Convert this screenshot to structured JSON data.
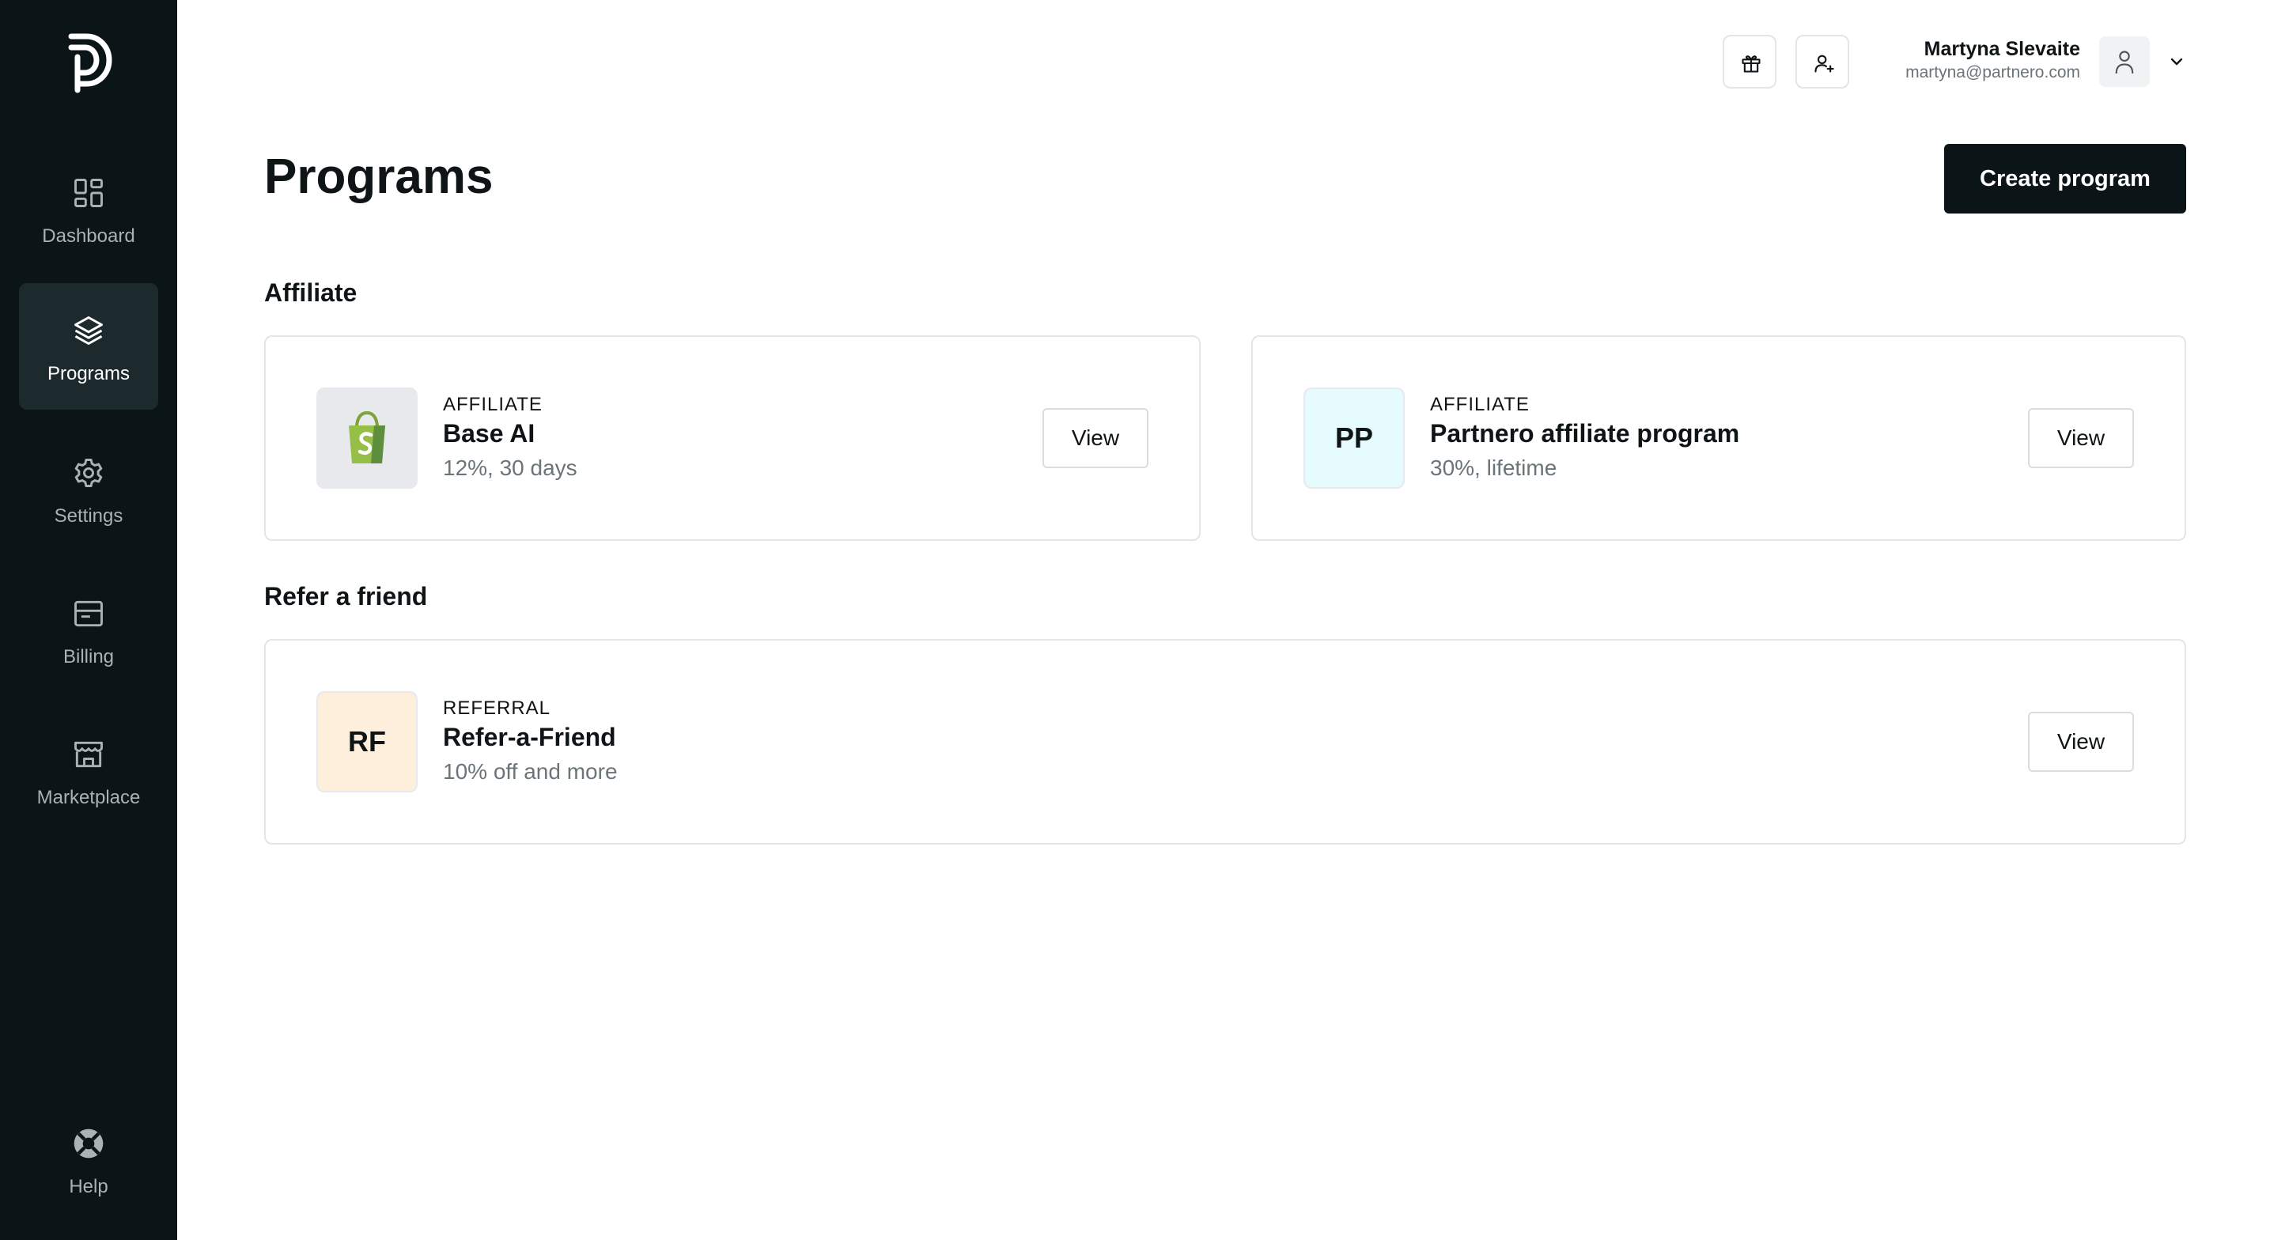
{
  "sidebar": {
    "items": [
      {
        "label": "Dashboard",
        "icon": "dashboard-grid-icon"
      },
      {
        "label": "Programs",
        "icon": "layers-icon",
        "active": true
      },
      {
        "label": "Settings",
        "icon": "gear-icon"
      },
      {
        "label": "Billing",
        "icon": "wallet-icon"
      },
      {
        "label": "Marketplace",
        "icon": "storefront-icon"
      }
    ],
    "help": {
      "label": "Help",
      "icon": "lifebuoy-icon"
    }
  },
  "topbar": {
    "gift_icon": "gift-icon",
    "invite_icon": "user-plus-icon",
    "user": {
      "name": "Martyna Slevaite",
      "email": "martyna@partnero.com",
      "avatar_icon": "user-icon",
      "menu_icon": "chevron-down-icon"
    }
  },
  "page": {
    "title": "Programs",
    "create_label": "Create program"
  },
  "sections": {
    "affiliate": {
      "title": "Affiliate",
      "programs": [
        {
          "kind": "AFFILIATE",
          "name": "Base AI",
          "detail": "12%, 30 days",
          "thumb_icon": "shopify-bag-icon",
          "view_label": "View"
        },
        {
          "kind": "AFFILIATE",
          "name": "Partnero affiliate program",
          "detail": "30%, lifetime",
          "initials": "PP",
          "thumb_color": "#e6fbfd",
          "view_label": "View"
        }
      ]
    },
    "referral": {
      "title": "Refer a friend",
      "programs": [
        {
          "kind": "REFERRAL",
          "name": "Refer-a-Friend",
          "detail": "10% off and more",
          "initials": "RF",
          "thumb_color": "#fdefdc",
          "view_label": "View"
        }
      ]
    }
  },
  "colors": {
    "sidebar_bg": "#0b1517",
    "primary_button": "#0b1517",
    "shopify_green": "#95bf47"
  }
}
